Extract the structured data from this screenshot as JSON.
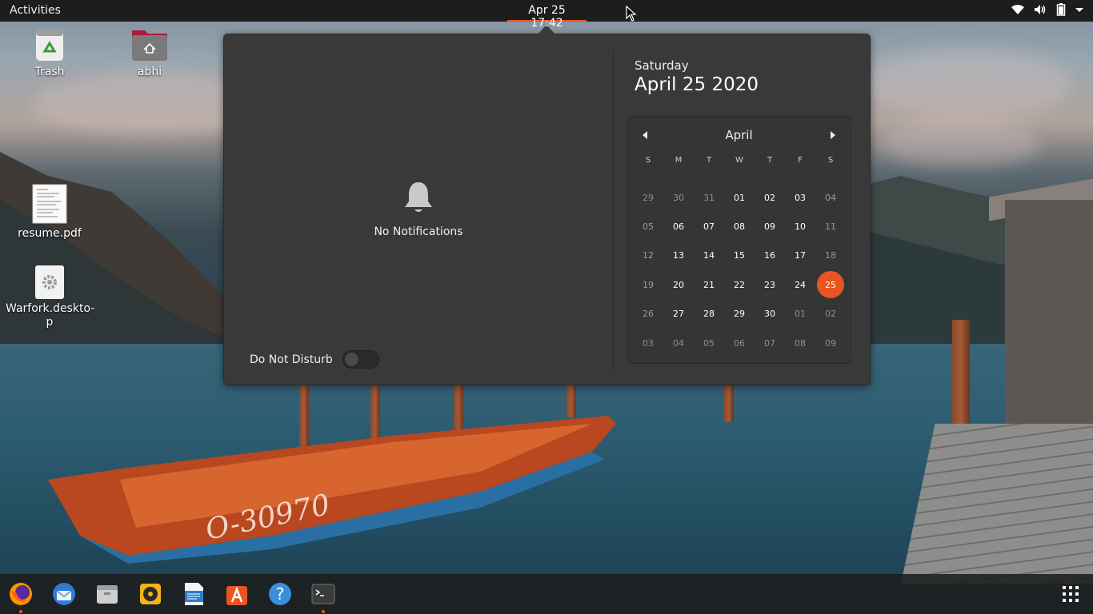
{
  "topbar": {
    "activities": "Activities",
    "clock_date": "Apr 25",
    "clock_time": "17:42",
    "tray_icons": [
      "wifi-icon",
      "volume-icon",
      "battery-icon",
      "system-menu-arrow-icon"
    ]
  },
  "desktop": {
    "icons": [
      {
        "label": "Trash",
        "icon": "trash-icon"
      },
      {
        "label": "abhi",
        "icon": "home-folder-icon"
      },
      {
        "label": "resume.pdf",
        "icon": "pdf-document-icon"
      },
      {
        "label": "Warfork.deskto-\np",
        "icon": "desktop-file-gear-icon"
      }
    ]
  },
  "popover": {
    "notifications_empty": "No Notifications",
    "do_not_disturb_label": "Do Not Disturb",
    "do_not_disturb_on": false,
    "weekday": "Saturday",
    "full_date": "April 25 2020",
    "calendar": {
      "month": "April",
      "days_of_week": [
        "S",
        "M",
        "T",
        "W",
        "T",
        "F",
        "S"
      ],
      "weeks": [
        [
          "29",
          "30",
          "31",
          "01",
          "02",
          "03",
          "04"
        ],
        [
          "05",
          "06",
          "07",
          "08",
          "09",
          "10",
          "11"
        ],
        [
          "12",
          "13",
          "14",
          "15",
          "16",
          "17",
          "18"
        ],
        [
          "19",
          "20",
          "21",
          "22",
          "23",
          "24",
          "25"
        ],
        [
          "26",
          "27",
          "28",
          "29",
          "30",
          "01",
          "02"
        ],
        [
          "03",
          "04",
          "05",
          "06",
          "07",
          "08",
          "09"
        ]
      ],
      "today": "25",
      "accent_color": "#e95420"
    }
  },
  "dock": {
    "apps": [
      {
        "name": "firefox-icon",
        "running": true
      },
      {
        "name": "thunderbird-icon",
        "running": false
      },
      {
        "name": "files-icon",
        "running": false
      },
      {
        "name": "rhythmbox-icon",
        "running": false
      },
      {
        "name": "libreoffice-writer-icon",
        "running": false
      },
      {
        "name": "software-center-icon",
        "running": false
      },
      {
        "name": "help-icon",
        "running": false
      },
      {
        "name": "terminal-icon",
        "running": true
      }
    ],
    "show_apps": "show-applications-icon"
  }
}
